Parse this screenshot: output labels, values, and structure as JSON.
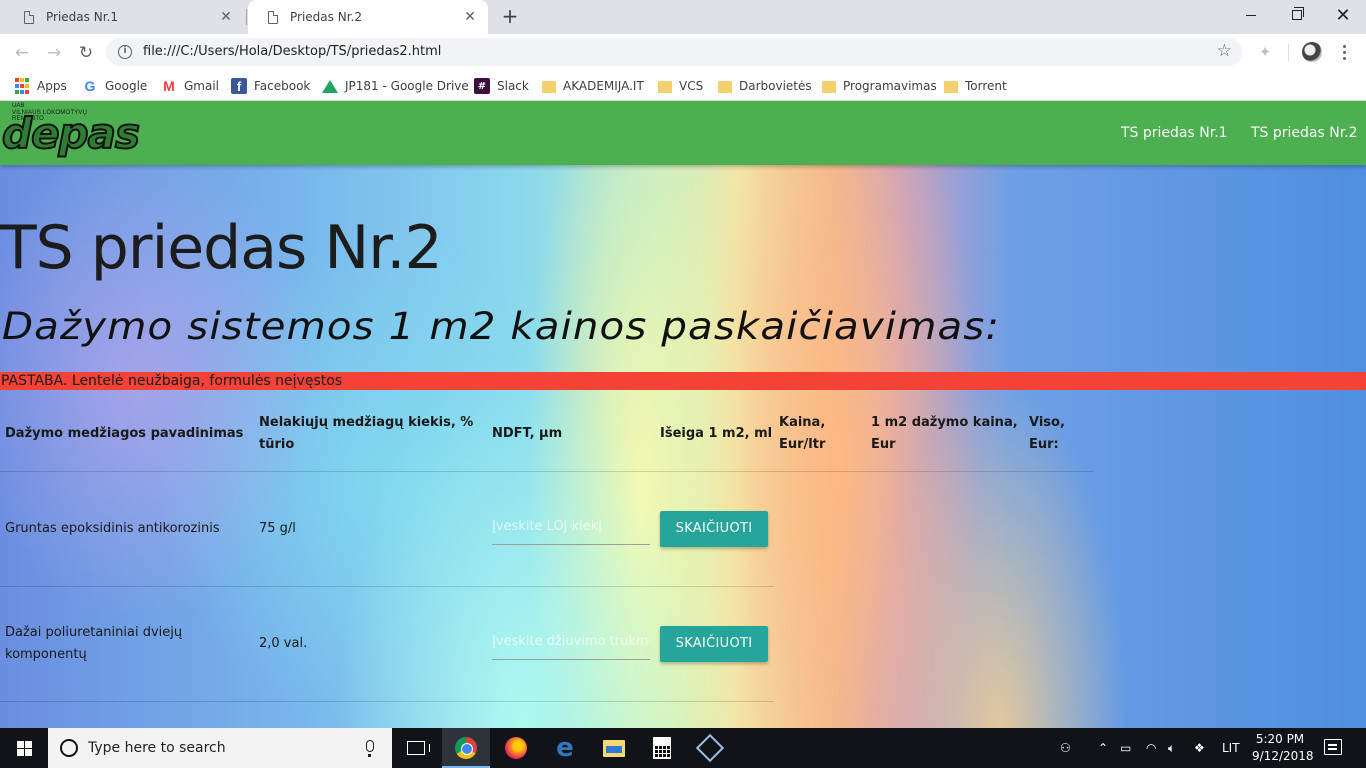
{
  "browser": {
    "tabs": [
      {
        "title": "Priedas Nr.1",
        "active": false
      },
      {
        "title": "Priedas Nr.2",
        "active": true
      }
    ],
    "new_tab_label": "+",
    "url": "file:///C:/Users/Hola/Desktop/TS/priedas2.html",
    "bookmarks": [
      {
        "label": "Apps",
        "icon": "apps-grid-icon"
      },
      {
        "label": "Google",
        "icon": "google-icon"
      },
      {
        "label": "Gmail",
        "icon": "gmail-icon"
      },
      {
        "label": "Facebook",
        "icon": "facebook-icon"
      },
      {
        "label": "JP181 - Google Drive",
        "icon": "google-drive-icon"
      },
      {
        "label": "Slack",
        "icon": "slack-icon"
      },
      {
        "label": "AKADEMIJA.IT",
        "icon": "folder-icon"
      },
      {
        "label": "VCS",
        "icon": "folder-icon"
      },
      {
        "label": "Darbovietės",
        "icon": "folder-icon"
      },
      {
        "label": "Programavimas",
        "icon": "folder-icon"
      },
      {
        "label": "Torrent",
        "icon": "folder-icon"
      }
    ]
  },
  "site": {
    "logo": {
      "line1": "UAB",
      "line2": "VILNIAUS LOKOMOTYVŲ REMONTO",
      "word": "depas"
    },
    "nav": [
      {
        "label": "TS priedas Nr.1"
      },
      {
        "label": "TS priedas Nr.2"
      }
    ],
    "title": "TS priedas Nr.2",
    "subtitle": "Dažymo sistemos 1 m2 kainos paskaičiavimas:",
    "note": "PASTABA. Lentelė neužbaiga, formulės neįvęstos",
    "colors": {
      "navbar": "#4caf50",
      "note": "#f44336",
      "button": "#26a69a"
    }
  },
  "table": {
    "headers": [
      "Dažymo medžiagos pavadinimas",
      "Nelakiųjų medžiagų kiekis, % tūrio",
      "NDFT, µm",
      "Išeiga 1 m2, ml",
      "Kaina, Eur/ltr",
      "1 m2 dažymo kaina, Eur",
      "Viso, Eur:"
    ],
    "rows": [
      {
        "name": "Gruntas epoksidinis antikorozinis",
        "amount": "75 g/l",
        "input_placeholder": "Įveskite LOJ kiekį",
        "button_label": "SKAIČIUOTI"
      },
      {
        "name": "Dažai poliuretaniniai dviejų komponentų",
        "amount": "2,0 val.",
        "input_placeholder": "Įveskite džiuvimo trukmę",
        "button_label": "SKAIČIUOTI"
      }
    ]
  },
  "taskbar": {
    "search_placeholder": "Type here to search",
    "apps": [
      "task-view-icon",
      "chrome-icon",
      "firefox-icon",
      "edge-icon",
      "file-explorer-icon",
      "calculator-icon",
      "virtualbox-icon"
    ],
    "language": "LIT",
    "time": "5:20 PM",
    "date": "9/12/2018"
  }
}
